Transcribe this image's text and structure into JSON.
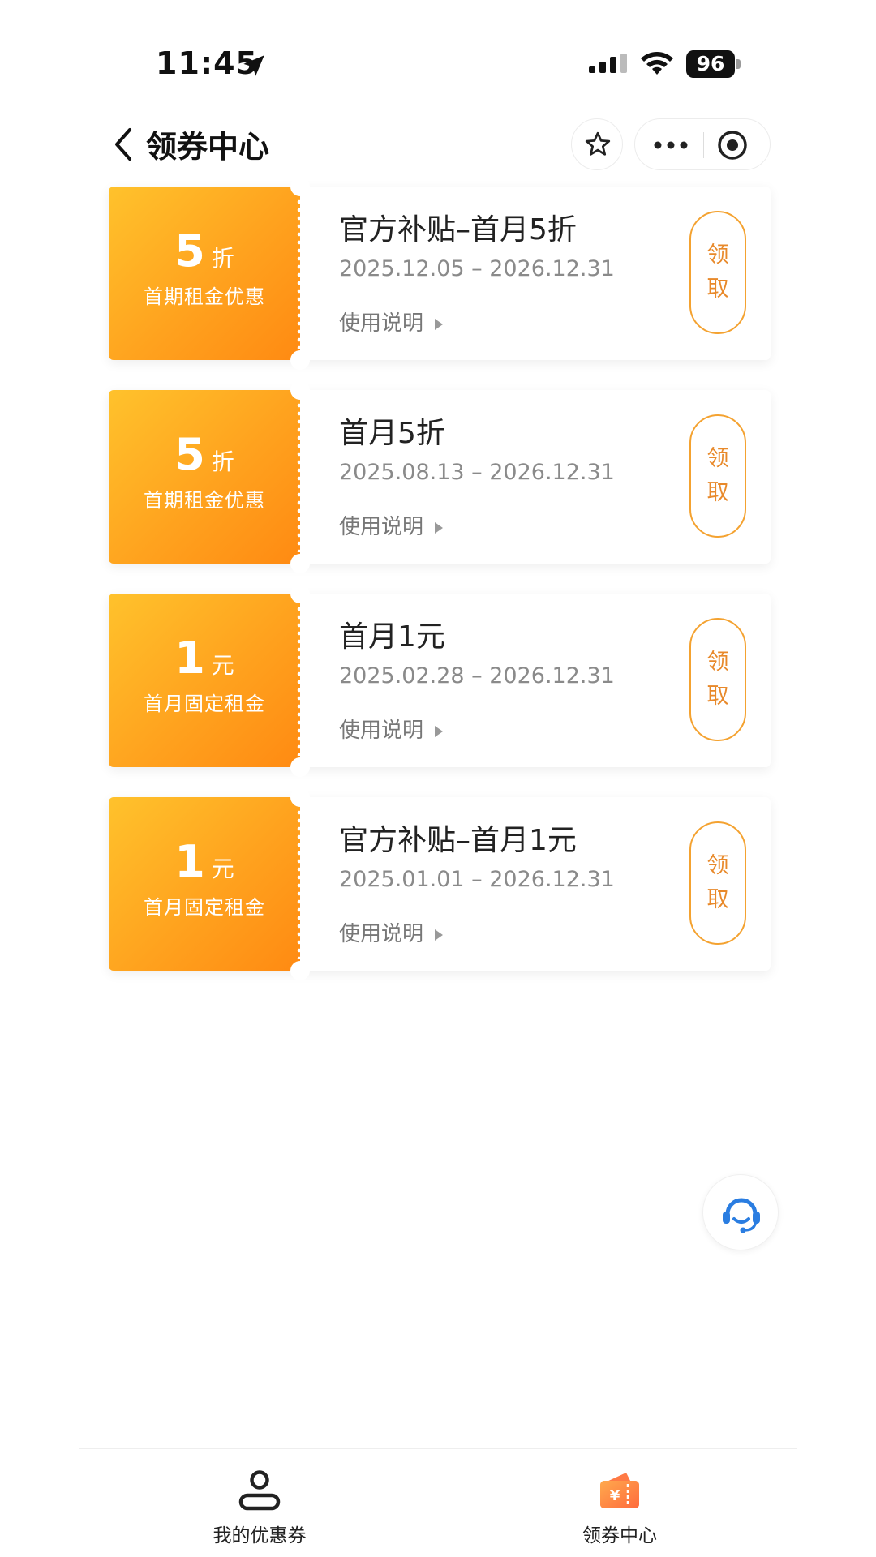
{
  "status_bar": {
    "time": "11:45",
    "battery": "96",
    "icons": [
      "location-arrow-icon",
      "signal-icon",
      "wifi-icon",
      "battery-icon"
    ]
  },
  "nav": {
    "title": "领券中心",
    "icons": [
      "back-icon",
      "star-icon",
      "more-icon",
      "close-miniprogram-icon"
    ]
  },
  "coupons": [
    {
      "amount": "5",
      "unit": "折",
      "desc": "首期租金优惠",
      "title": "官方补贴–首月5折",
      "date": "2025.12.05 – 2026.12.31",
      "usage_label": "使用说明",
      "claim_chars": [
        "领",
        "取"
      ]
    },
    {
      "amount": "5",
      "unit": "折",
      "desc": "首期租金优惠",
      "title": "首月5折",
      "date": "2025.08.13 – 2026.12.31",
      "usage_label": "使用说明",
      "claim_chars": [
        "领",
        "取"
      ]
    },
    {
      "amount": "1",
      "unit": "元",
      "desc": "首月固定租金",
      "title": "首月1元",
      "date": "2025.02.28 – 2026.12.31",
      "usage_label": "使用说明",
      "claim_chars": [
        "领",
        "取"
      ]
    },
    {
      "amount": "1",
      "unit": "元",
      "desc": "首月固定租金",
      "title": "官方补贴–首月1元",
      "date": "2025.01.01 – 2026.12.31",
      "usage_label": "使用说明",
      "claim_chars": [
        "领",
        "取"
      ]
    }
  ],
  "tabs": [
    {
      "label": "我的优惠券",
      "icon": "user-icon",
      "active": false
    },
    {
      "label": "领券中心",
      "icon": "ticket-icon",
      "active": true
    }
  ],
  "service": {
    "icon": "headset-icon"
  },
  "colors": {
    "accent": "#ff9d1c",
    "accent_light": "#ffc22c",
    "claim_text": "#e8892a",
    "service_blue": "#2a7de1"
  }
}
